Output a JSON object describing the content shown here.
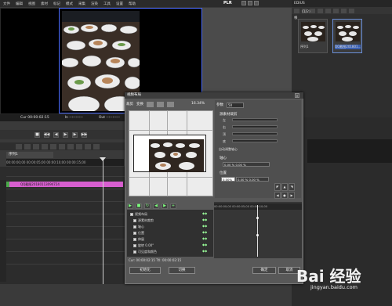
{
  "menu": {
    "items": [
      "文件",
      "编辑",
      "视图",
      "素材",
      "标记",
      "模式",
      "采集",
      "渲染",
      "工具",
      "设置",
      "帮助"
    ]
  },
  "player_label": "PLR",
  "viewer": {
    "cur_label": "Cur 00:00:02:15",
    "in_label": "In --:--:--:--",
    "out_label": "Out --:--:--:--"
  },
  "bin": {
    "title": "EDIUS",
    "folder_label": "根",
    "count": "(1/2)",
    "thumbs": [
      {
        "label": "序列1"
      },
      {
        "label": "QQ截图201801..."
      }
    ]
  },
  "sequence": {
    "tab_label": "序列1",
    "ruler_text": "00:00:00;00      00:00:05;00      00:00:10;00      00:00:15;00",
    "clip_label": "QQ截图20180113094724"
  },
  "dialog": {
    "title": "视频布局",
    "tool_labels": [
      "裁剪",
      "变换"
    ],
    "zoom": "16.34%",
    "param_label": "参数",
    "param_value": "50",
    "groups": {
      "crop": "源素材裁剪",
      "anchor": "轴心",
      "position": "位置"
    },
    "crop_rows": [
      "左",
      "右",
      "顶",
      "底"
    ],
    "keep_aspect": "自动调整轴心",
    "anchor_value": "0.00 %   0.00 %",
    "position_value": "0.00 %   0.00 %",
    "position_sel": "0.00%",
    "kf_rows": [
      "视频布局",
      "源素材裁剪",
      "轴心",
      "位置",
      "伸展",
      "旋转  0.00°",
      "可见度和颜色"
    ],
    "kf_ruler": "00:00:00;00   00:00:05;00   00:00:10;00",
    "cur_text": "Cur: 00:00:02:15   Ttl: 00:00:02:15",
    "buttons": {
      "default": "初始化",
      "reset": "切换",
      "ok": "确定",
      "cancel": "取消"
    }
  },
  "watermark": {
    "text": "Bai 经验",
    "url": "jingyan.baidu.com"
  }
}
